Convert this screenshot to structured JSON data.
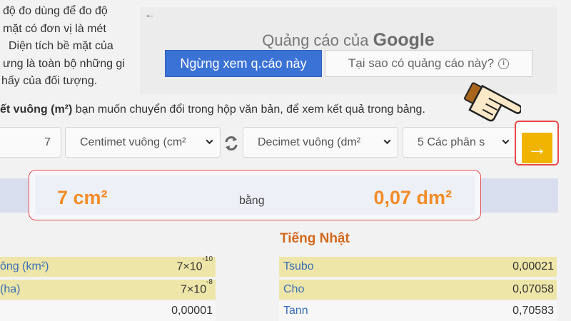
{
  "intro_lines": [
    "độ đo dùng để đo độ",
    "mặt có đơn vị là mét",
    "Diện tích bề mặt của",
    "ưng là toàn bộ những gi",
    "hấy của đối tượng."
  ],
  "ad": {
    "back_icon": "←",
    "title": "Quảng cáo của",
    "brand": "Google",
    "stop_button": "Ngừng xem q.cáo này",
    "why_button": "Tại sao có quảng cáo này?",
    "info_icon": "i"
  },
  "instruction": {
    "bold": "ết vuông (m²)",
    "rest": " bạn muốn chuyển đổi trong hộp văn bản, để xem kết quả trong bảng."
  },
  "converter": {
    "quantity": "7",
    "from_unit": "Centimet vuông (cm²",
    "to_unit": "Decimet vuông (dm²",
    "precision": "5 Các phân s",
    "swap_icon": "⇄",
    "go_icon": "→"
  },
  "result": {
    "from_value": "7 cm²",
    "equals_label": "bằng",
    "to_value": "0,07 dm²"
  },
  "japanese_heading": "Tiếng Nhật",
  "left_table": [
    {
      "name": "ông (km²)",
      "mantissa": "7×10",
      "exp": "-10"
    },
    {
      "name": "(ha)",
      "mantissa": "7×10",
      "exp": "-8"
    },
    {
      "name": "",
      "mantissa": "0,00001",
      "exp": ""
    }
  ],
  "right_table": [
    {
      "name": "Tsubo",
      "value": "0,00021"
    },
    {
      "name": "Cho",
      "value": "0,07058"
    },
    {
      "name": "Tann",
      "value": "0,70583"
    }
  ],
  "colors": {
    "accent_orange": "#f28c28",
    "go_yellow": "#f0b400",
    "ad_blue": "#3b72d6",
    "highlight_red": "#e24d4d"
  }
}
